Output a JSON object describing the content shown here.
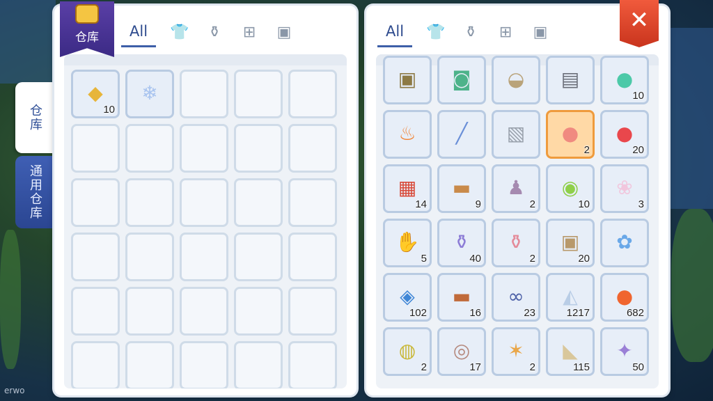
{
  "side_tabs": [
    {
      "label": "仓库",
      "active": true
    },
    {
      "label": "通用仓库",
      "active": false
    }
  ],
  "left_panel": {
    "badge_label": "仓库",
    "tabs": [
      {
        "label": "All",
        "icon": "all"
      },
      {
        "label": "",
        "icon": "armor-icon"
      },
      {
        "label": "",
        "icon": "potion-icon"
      },
      {
        "label": "",
        "icon": "grid-icon"
      },
      {
        "label": "",
        "icon": "card-icon"
      }
    ],
    "items": [
      {
        "name": "golden-box-icon",
        "qty": "10",
        "color": "#e7b53a",
        "glyph": "◆"
      },
      {
        "name": "crystal-cart-icon",
        "qty": "",
        "color": "#a9c4ef",
        "glyph": "❄"
      }
    ],
    "empty_slots": 28
  },
  "right_panel": {
    "close_label": "✕",
    "tabs": [
      {
        "label": "All",
        "icon": "all"
      },
      {
        "label": "",
        "icon": "armor-icon"
      },
      {
        "label": "",
        "icon": "potion-icon"
      },
      {
        "label": "",
        "icon": "grid-icon"
      },
      {
        "label": "",
        "icon": "card-icon"
      }
    ],
    "items": [
      {
        "name": "crate-icon",
        "qty": "",
        "color": "#8d7a45",
        "glyph": "▣"
      },
      {
        "name": "backpack-icon",
        "qty": "",
        "color": "#4db38a",
        "glyph": "◙"
      },
      {
        "name": "mortar-bowl-icon",
        "qty": "",
        "color": "#b9a37a",
        "glyph": "◒"
      },
      {
        "name": "food-cards-icon",
        "qty": "",
        "color": "#6a6e78",
        "glyph": "▤"
      },
      {
        "name": "green-slime-icon",
        "qty": "10",
        "color": "#4cc9a8",
        "glyph": "●"
      },
      {
        "name": "fire-icon",
        "qty": "",
        "color": "#f2802e",
        "glyph": "♨"
      },
      {
        "name": "ice-wand-icon",
        "qty": "",
        "color": "#6a8fd8",
        "glyph": "╱"
      },
      {
        "name": "grey-backpack-icon",
        "qty": "",
        "color": "#9aa2ad",
        "glyph": "▧"
      },
      {
        "name": "pink-poring-card-icon",
        "qty": "2",
        "color": "#f08a80",
        "glyph": "●",
        "selected": true
      },
      {
        "name": "red-poring-icon",
        "qty": "20",
        "color": "#e9474c",
        "glyph": "●"
      },
      {
        "name": "red-gift-box-icon",
        "qty": "14",
        "color": "#d84a3a",
        "glyph": "▦"
      },
      {
        "name": "food-tray-icon",
        "qty": "9",
        "color": "#c98a4a",
        "glyph": "▬"
      },
      {
        "name": "mage-doll-icon",
        "qty": "2",
        "color": "#a58ab0",
        "glyph": "♟"
      },
      {
        "name": "lime-icon",
        "qty": "10",
        "color": "#8fcf4a",
        "glyph": "◉"
      },
      {
        "name": "white-bunny-icon",
        "qty": "3",
        "color": "#f1c6dd",
        "glyph": "❀"
      },
      {
        "name": "hand-icon",
        "qty": "5",
        "color": "#ead3bd",
        "glyph": "✋"
      },
      {
        "name": "purple-bottle-icon",
        "qty": "40",
        "color": "#8c7cd6",
        "glyph": "⚱"
      },
      {
        "name": "pink-vase-icon",
        "qty": "2",
        "color": "#e48a99",
        "glyph": "⚱"
      },
      {
        "name": "treasure-chest-icon",
        "qty": "20",
        "color": "#b8996b",
        "glyph": "▣"
      },
      {
        "name": "blue-rose-icon",
        "qty": "",
        "color": "#6aa8e8",
        "glyph": "✿"
      },
      {
        "name": "blue-scroll-icon",
        "qty": "102",
        "color": "#3f86d6",
        "glyph": "◈"
      },
      {
        "name": "roast-platter-icon",
        "qty": "16",
        "color": "#c06a3a",
        "glyph": "▬"
      },
      {
        "name": "chain-icon",
        "qty": "23",
        "color": "#4b5fa6",
        "glyph": "∞"
      },
      {
        "name": "crystal-shard-icon",
        "qty": "1217",
        "color": "#b9cde6",
        "glyph": "◭"
      },
      {
        "name": "apple-icon",
        "qty": "682",
        "color": "#f0652f",
        "glyph": "●"
      },
      {
        "name": "green-fruit-icon",
        "qty": "2",
        "color": "#c9b83a",
        "glyph": "◍"
      },
      {
        "name": "cat-coin-icon",
        "qty": "17",
        "color": "#b5897e",
        "glyph": "◎"
      },
      {
        "name": "sheriff-badge-icon",
        "qty": "2",
        "color": "#e9a648",
        "glyph": "✶"
      },
      {
        "name": "cheese-wedge-icon",
        "qty": "115",
        "color": "#d9c79b",
        "glyph": "◣"
      },
      {
        "name": "purple-gem-icon",
        "qty": "50",
        "color": "#9a7fd6",
        "glyph": "✦"
      }
    ]
  },
  "watermark": "erwo"
}
